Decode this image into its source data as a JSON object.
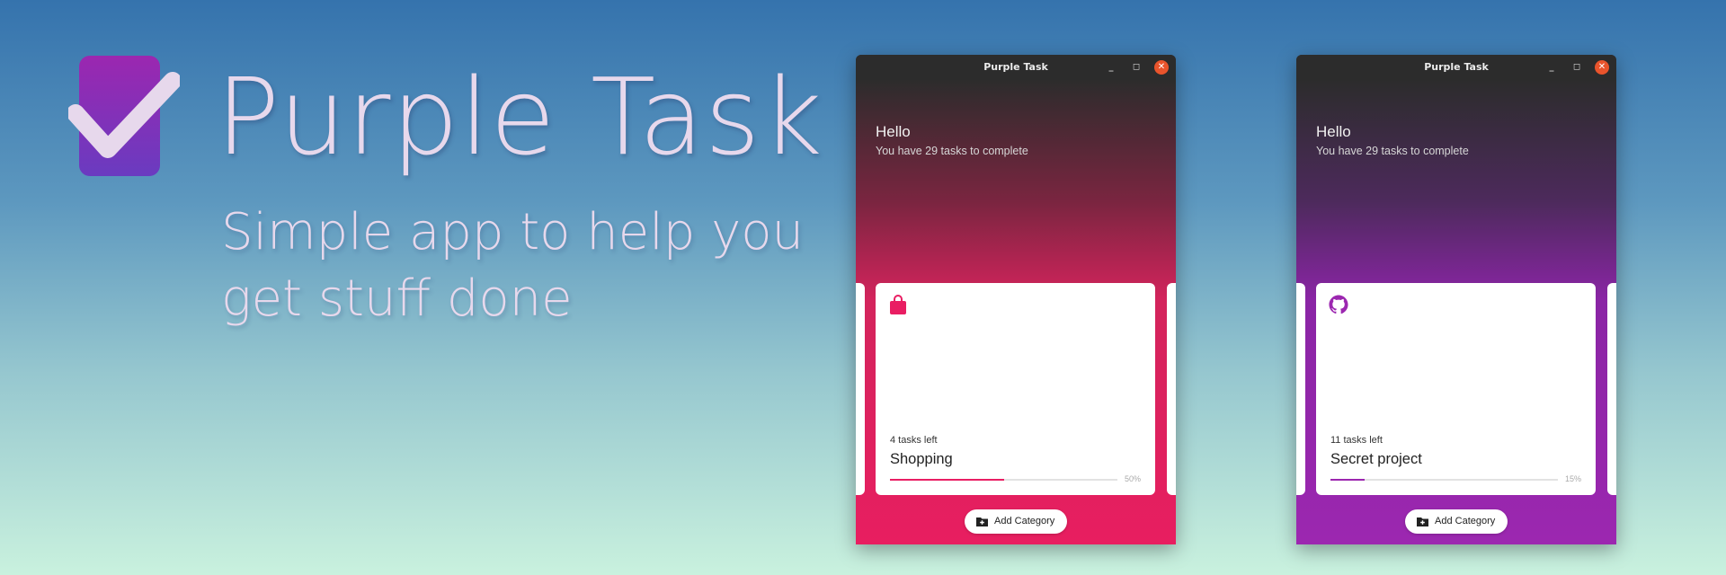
{
  "hero": {
    "title": "Purple Task",
    "tagline_line1": "Simple app to help you",
    "tagline_line2": "get stuff done"
  },
  "windows": [
    {
      "title": "Purple Task",
      "greeting": "Hello",
      "subtitle": "You have 29 tasks to complete",
      "card": {
        "icon": "shopping-bag-icon",
        "tasks_left": "4 tasks left",
        "name": "Shopping",
        "progress": 0.5,
        "progress_label": "50%",
        "accent": "#e91e63"
      },
      "add_category_label": "Add Category"
    },
    {
      "title": "Purple Task",
      "greeting": "Hello",
      "subtitle": "You have 29 tasks to complete",
      "card": {
        "icon": "github-icon",
        "tasks_left": "11 tasks left",
        "name": "Secret project",
        "progress": 0.15,
        "progress_label": "15%",
        "accent": "#9c27b0"
      },
      "add_category_label": "Add Category"
    }
  ],
  "colors": {
    "logo_purple": "#8e24aa",
    "pink_accent": "#e91e63",
    "purple_accent": "#9c27b0",
    "titlebar": "#2c2c2c",
    "close_button": "#e9542c"
  }
}
